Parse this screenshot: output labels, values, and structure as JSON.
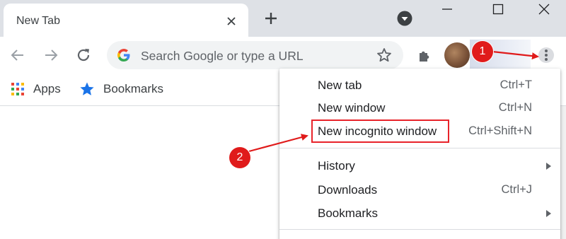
{
  "tab": {
    "title": "New Tab"
  },
  "omnibox": {
    "placeholder": "Search Google or type a URL"
  },
  "bookmarks_bar": {
    "items": [
      {
        "label": "Apps"
      },
      {
        "label": "Bookmarks"
      }
    ]
  },
  "menu": {
    "items": [
      {
        "label": "New tab",
        "shortcut": "Ctrl+T"
      },
      {
        "label": "New window",
        "shortcut": "Ctrl+N"
      },
      {
        "label": "New incognito window",
        "shortcut": "Ctrl+Shift+N"
      },
      {
        "label": "History",
        "submenu": true
      },
      {
        "label": "Downloads",
        "shortcut": "Ctrl+J"
      },
      {
        "label": "Bookmarks",
        "submenu": true
      }
    ]
  },
  "annotations": {
    "badge_1": "1",
    "badge_2": "2"
  },
  "colors": {
    "annotation_red": "#e01b1b",
    "tabstrip": "#dee1e6",
    "accent_blue": "#1a73e8"
  }
}
